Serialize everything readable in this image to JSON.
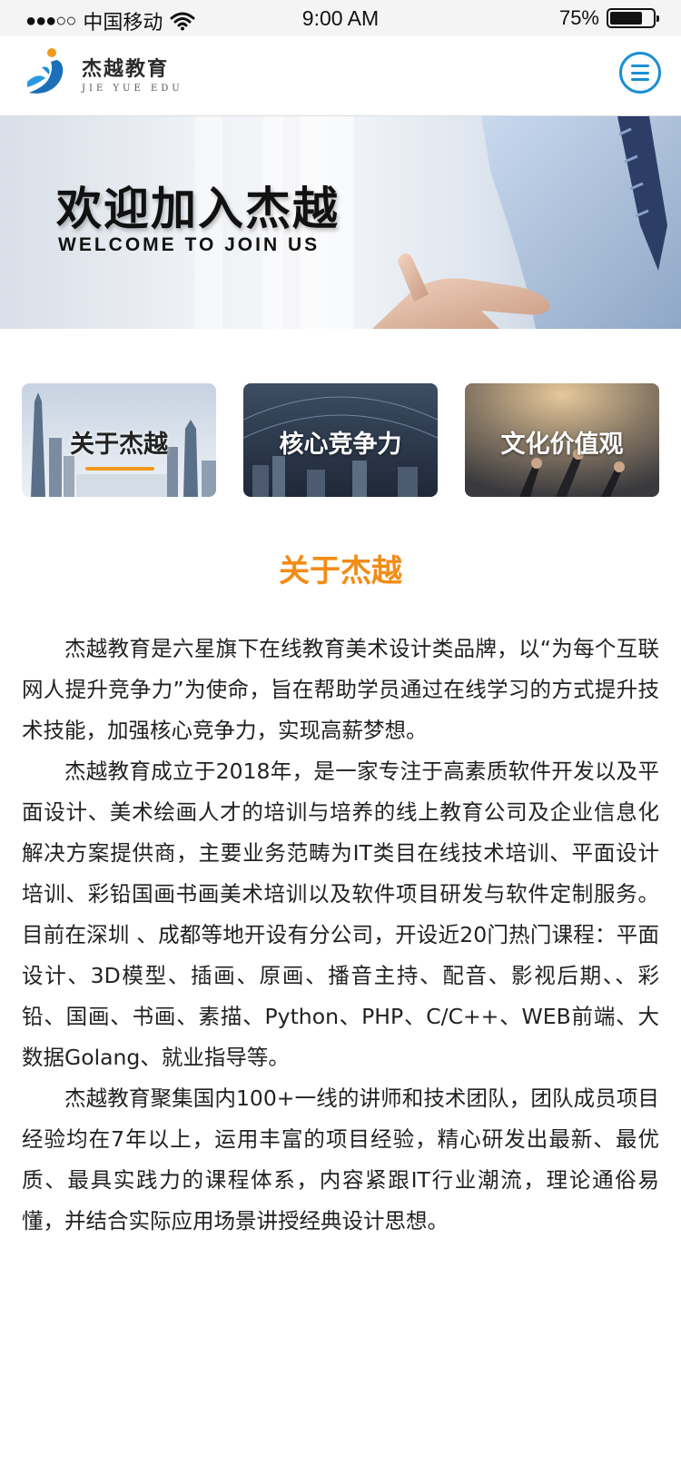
{
  "status_bar": {
    "signal": "●●●○○",
    "carrier": "中国移动",
    "time": "9:00 AM",
    "battery_percent": "75%",
    "battery_level": 0.75
  },
  "header": {
    "logo_cn": "杰越教育",
    "logo_en": "JIE YUE EDU",
    "accent_color": "#1a8fd5"
  },
  "banner": {
    "title": "欢迎加入杰越",
    "subtitle": "WELCOME TO JOIN US"
  },
  "cards": [
    {
      "label": "关于杰越",
      "active": true
    },
    {
      "label": "核心竞争力",
      "active": false
    },
    {
      "label": "文化价值观",
      "active": false
    }
  ],
  "section": {
    "title": "关于杰越",
    "title_color": "#f28c16",
    "paragraphs": [
      "杰越教育是六星旗下在线教育美术设计类品牌，以“为每个互联网人提升竞争力”为使命，旨在帮助学员通过在线学习的方式提升技术技能，加强核心竞争力，实现高薪梦想。",
      "杰越教育成立于2018年，是一家专注于高素质软件开发以及平面设计、美术绘画人才的培训与培养的线上教育公司及企业信息化解决方案提供商，主要业务范畴为IT类目在线技术培训、平面设计培训、彩铅国画书画美术培训以及软件项目研发与软件定制服务。 目前在深圳 、成都等地开设有分公司，开设近20门热门课程：平面设计、3D模型、插画、原画、播音主持、配音、影视后期、、彩铅、国画、书画、素描、Python、PHP、C/C++、WEB前端、大数据Golang、就业指导等。",
      "杰越教育聚集国内100+一线的讲师和技术团队，团队成员项目经验均在7年以上，运用丰富的项目经验，精心研发出最新、最优质、最具实践力的课程体系，内容紧跟IT行业潮流，理论通俗易懂，并结合实际应用场景讲授经典设计思想。"
    ]
  }
}
